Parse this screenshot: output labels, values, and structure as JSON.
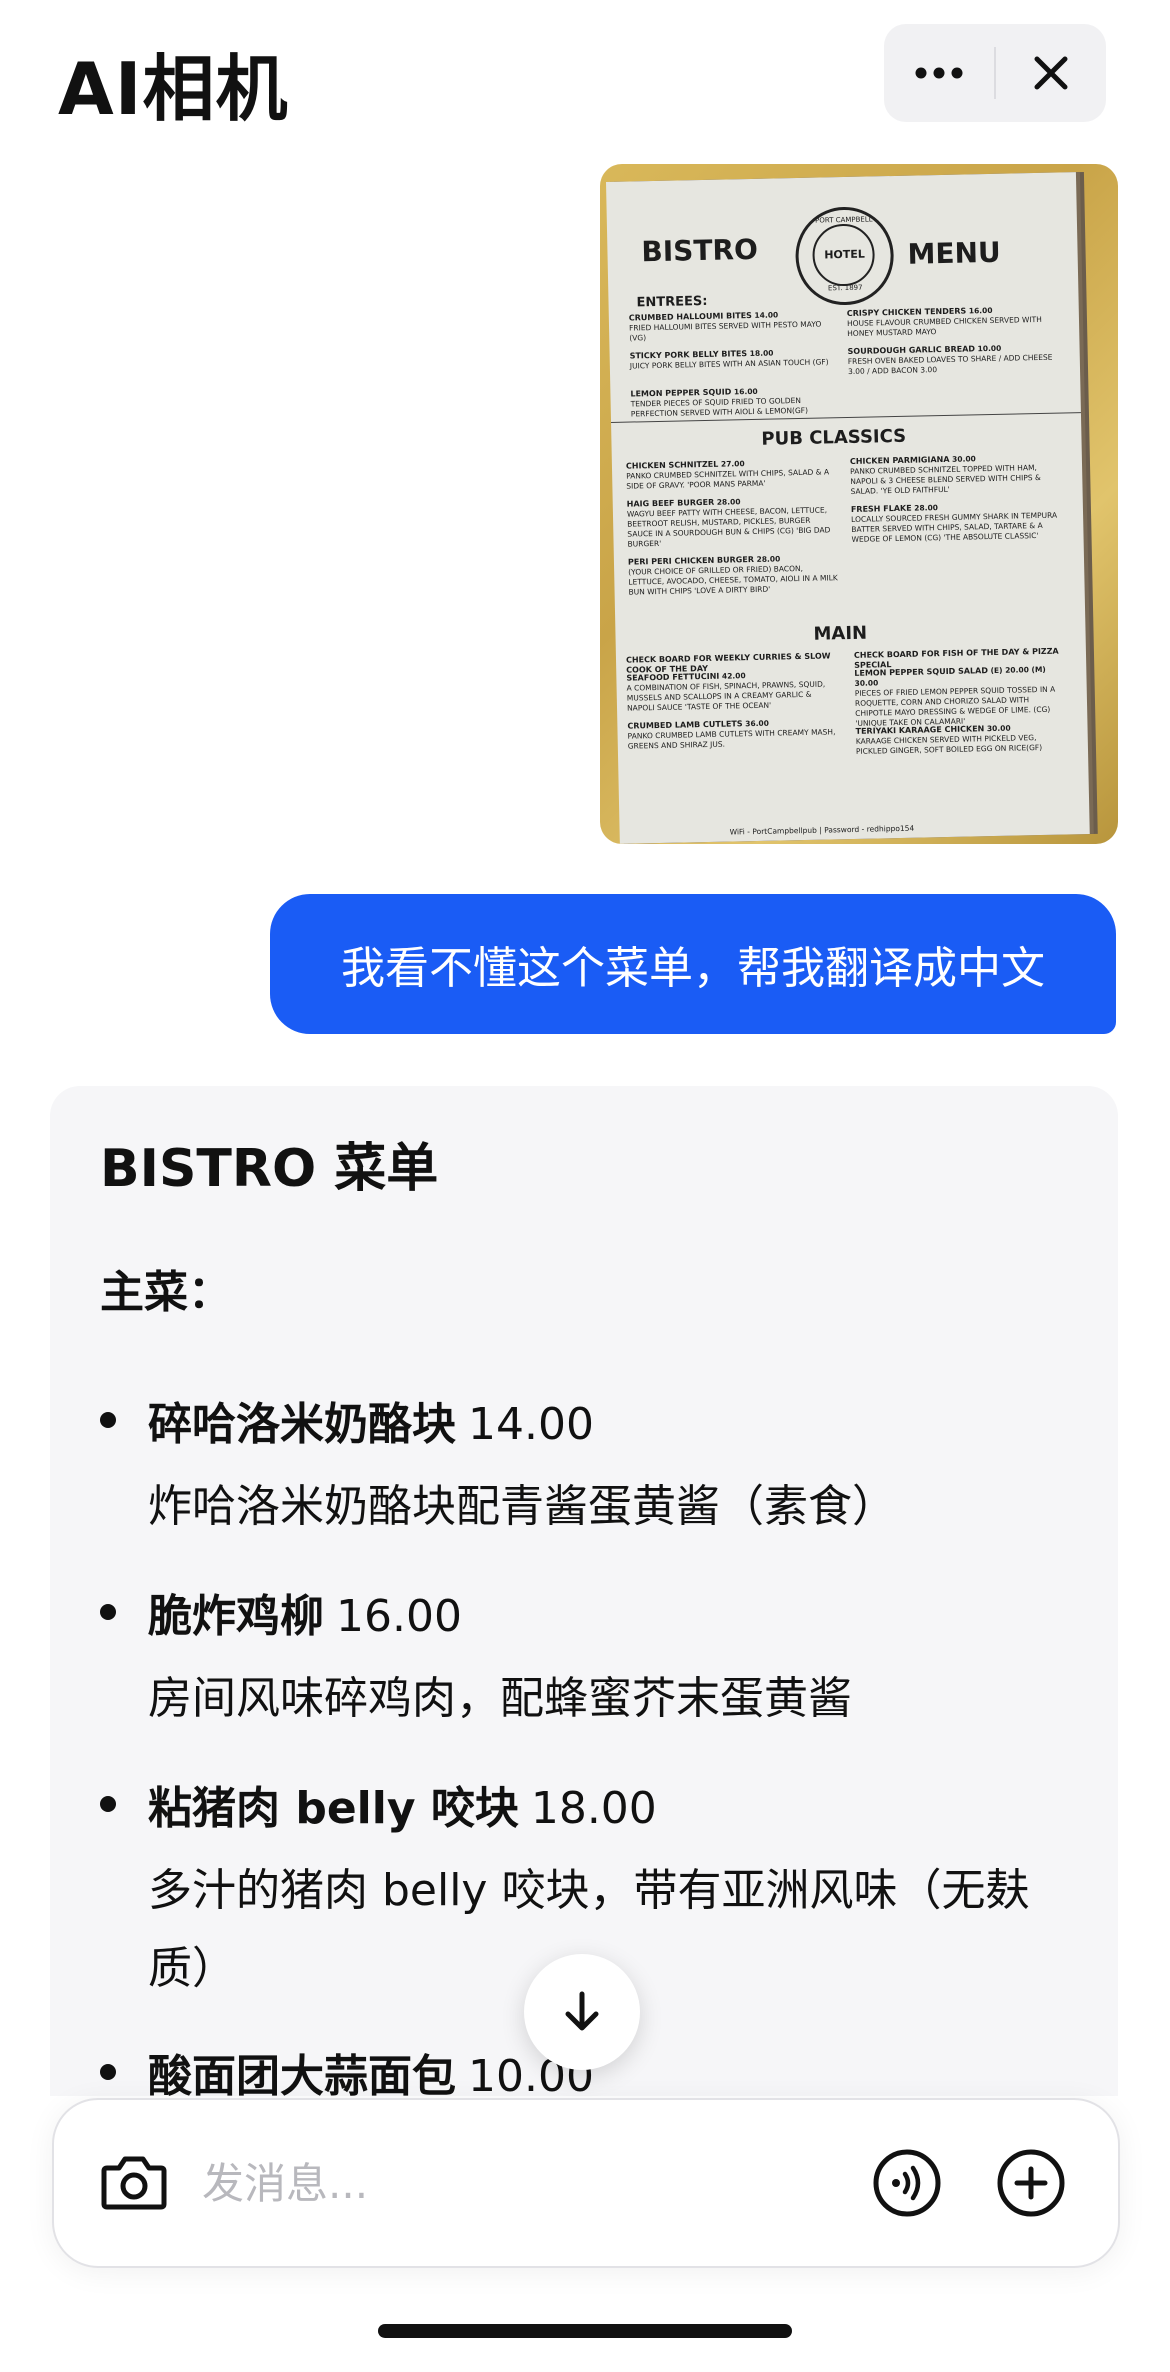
{
  "header": {
    "title": "AI相机",
    "more_icon": "more-dots-icon",
    "close_icon": "close-icon"
  },
  "menu_photo": {
    "left_title": "BISTRO",
    "right_title": "MENU",
    "seal_top": "PORT CAMPBELL",
    "seal_center": "HOTEL",
    "seal_bottom": "EST. 1897",
    "entrees_heading": "ENTREES:",
    "pub_heading": "PUB CLASSICS",
    "main_heading": "MAIN",
    "wifi_line": "WiFi - PortCampbellpub | Password - redhippo154",
    "entrees_left": [
      {
        "name": "CRUMBED HALLOUMI BITES",
        "price": "14.00",
        "desc": "FRIED HALLOUMI BITES SERVED WITH PESTO MAYO (VG)"
      },
      {
        "name": "STICKY PORK BELLY BITES",
        "price": "18.00",
        "desc": "JUICY PORK BELLY BITES WITH AN ASIAN TOUCH (GF)"
      },
      {
        "name": "LEMON PEPPER SQUID",
        "price": "16.00",
        "desc": "TENDER PIECES OF SQUID FRIED TO GOLDEN PERFECTION SERVED WITH AIOLI & LEMON(GF)"
      }
    ],
    "entrees_right": [
      {
        "name": "CRISPY CHICKEN TENDERS",
        "price": "16.00",
        "desc": "HOUSE FLAVOUR CRUMBED CHICKEN SERVED WITH HONEY MUSTARD MAYO"
      },
      {
        "name": "SOURDOUGH GARLIC BREAD",
        "price": "10.00",
        "desc": "FRESH OVEN BAKED LOAVES TO SHARE / ADD CHEESE 3.00 / ADD BACON 3.00"
      }
    ],
    "pub_left": [
      {
        "name": "CHICKEN SCHNITZEL",
        "price": "27.00",
        "desc": "PANKO CRUMBED SCHNITZEL WITH CHIPS, SALAD & A SIDE OF GRAVY. 'POOR MANS PARMA'"
      },
      {
        "name": "HAIG BEEF BURGER",
        "price": "28.00",
        "desc": "WAGYU BEEF PATTY WITH CHEESE, BACON, LETTUCE, BEETROOT RELISH, MUSTARD, PICKLES, BURGER SAUCE IN A SOURDOUGH BUN & CHIPS (CG) 'BIG DAD BURGER'"
      },
      {
        "name": "PERI PERI CHICKEN BURGER",
        "price": "28.00",
        "desc": "(YOUR CHOICE OF GRILLED OR FRIED) BACON, LETTUCE, AVOCADO, CHEESE, TOMATO, AIOLI IN A MILK BUN WITH CHIPS 'LOVE A DIRTY BIRD'"
      }
    ],
    "pub_right": [
      {
        "name": "CHICKEN PARMIGIANA",
        "price": "30.00",
        "desc": "PANKO CRUMBED SCHNITZEL TOPPED WITH HAM, NAPOLI & 3 CHEESE BLEND SERVED WITH CHIPS & SALAD. 'YE OLD FAITHFUL'"
      },
      {
        "name": "FRESH FLAKE",
        "price": "28.00",
        "desc": "LOCALLY SOURCED FRESH GUMMY SHARK IN TEMPURA BATTER SERVED WITH CHIPS, SALAD, TARTARE & A WEDGE OF LEMON (CG) 'THE ABSOLUTE CLASSIC'"
      }
    ],
    "main_left": [
      {
        "name": "CHECK BOARD FOR WEEKLY CURRIES & SLOW COOK OF THE DAY",
        "price": "",
        "desc": ""
      },
      {
        "name": "SEAFOOD FETTUCINI",
        "price": "42.00",
        "desc": "A COMBINATION OF FISH, SPINACH, PRAWNS, SQUID, MUSSELS AND SCALLOPS IN A CREAMY GARLIC & NAPOLI SAUCE 'TASTE OF THE OCEAN'"
      },
      {
        "name": "CRUMBED LAMB CUTLETS",
        "price": "36.00",
        "desc": "PANKO CRUMBED LAMB CUTLETS WITH CREAMY MASH, GREENS AND SHIRAZ JUS."
      }
    ],
    "main_right": [
      {
        "name": "CHECK BOARD FOR FISH OF THE DAY & PIZZA SPECIAL",
        "price": "",
        "desc": ""
      },
      {
        "name": "LEMON PEPPER SQUID SALAD",
        "price": "(E) 20.00 (M) 30.00",
        "desc": "PIECES OF FRIED LEMON PEPPER SQUID TOSSED IN A ROQUETTE, CORN AND CHORIZO SALAD WITH CHIPOTLE MAYO DRESSING & WEDGE OF LIME. (CG) 'UNIQUE TAKE ON CALAMARI'"
      },
      {
        "name": "TERIYAKI KARAAGE CHICKEN",
        "price": "30.00",
        "desc": "KARAAGE CHICKEN SERVED WITH PICKELD VEG, PICKLED GINGER, SOFT BOILED EGG ON RICE(GF)"
      }
    ]
  },
  "user_message": "我看不懂这个菜单，帮我翻译成中文",
  "ai_reply": {
    "title": "BISTRO 菜单",
    "section": "主菜：",
    "dishes": [
      {
        "name": "碎哈洛米奶酪块",
        "price": "14.00",
        "desc": "炸哈洛米奶酪块配青酱蛋黄酱（素食）"
      },
      {
        "name": "脆炸鸡柳",
        "price": "16.00",
        "desc": "房间风味碎鸡肉，配蜂蜜芥末蛋黄酱"
      },
      {
        "name": "粘猪肉 belly 咬块",
        "price": "18.00",
        "desc": "多汁的猪肉 belly 咬块，带有亚洲风味（无麸质）"
      },
      {
        "name": "酸面团大蒜面包",
        "price": "10.00",
        "desc": ""
      }
    ]
  },
  "composer": {
    "placeholder": "发消息...",
    "camera_icon": "camera-icon",
    "voice_icon": "voice-call-icon",
    "add_icon": "plus-circle-icon",
    "scroll_icon": "arrow-down-icon"
  },
  "colors": {
    "accent_blue": "#1a5cf5",
    "card_bg": "#f6f6f8",
    "placeholder": "#b8b8bd"
  }
}
